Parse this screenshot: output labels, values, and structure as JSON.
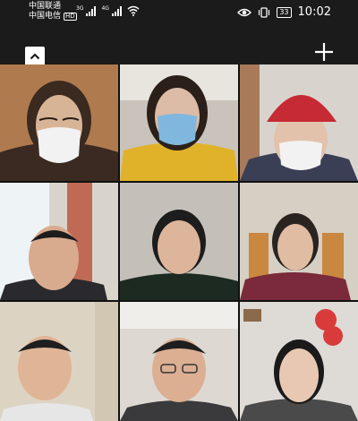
{
  "status_bar": {
    "carrier_1": "中国联通",
    "carrier_2": "中国电信",
    "hd_badge": "HD",
    "network_1": "3G",
    "network_2": "4G",
    "battery": "33",
    "time": "10:02"
  },
  "toolbar": {
    "collapse_icon": "chevron-up-icon",
    "add_icon": "plus-icon"
  },
  "participants": [
    {
      "id": "participant-1",
      "mask": "white",
      "hair": "#3a2a20",
      "top": "#3a2a22",
      "bg": "#b07a4f"
    },
    {
      "id": "participant-2",
      "mask": "blue",
      "hair": "#2b1f1a",
      "top": "#e0b22a",
      "bg": "#c9c3bb"
    },
    {
      "id": "participant-3",
      "mask": "white",
      "hat": "red",
      "top": "#3a3f55",
      "bg": "#d8d4cd"
    },
    {
      "id": "participant-4",
      "mask": "none",
      "hair": "#1d1d1d",
      "top": "#2a2a2e",
      "bg": "#d8d4cb"
    },
    {
      "id": "participant-5",
      "mask": "none",
      "hair": "#1d1d1d",
      "top": "#1d2a22",
      "bg": "#c4c0b9"
    },
    {
      "id": "participant-6",
      "mask": "none",
      "hair": "#2a2421",
      "top": "#7a2a3a",
      "bg": "#d6cfc4"
    },
    {
      "id": "participant-7",
      "mask": "none",
      "hair": "#1f1f1f",
      "top": "#e6e6e6",
      "bg": "#ddd3c3"
    },
    {
      "id": "participant-8",
      "mask": "none",
      "hair": "#1e1e1e",
      "top": "#3a3a3c",
      "bg": "#ddd9d2"
    },
    {
      "id": "participant-9",
      "mask": "none",
      "hair": "#1a1a1a",
      "top": "#4a4a4a",
      "bg": "#dedad6"
    }
  ]
}
